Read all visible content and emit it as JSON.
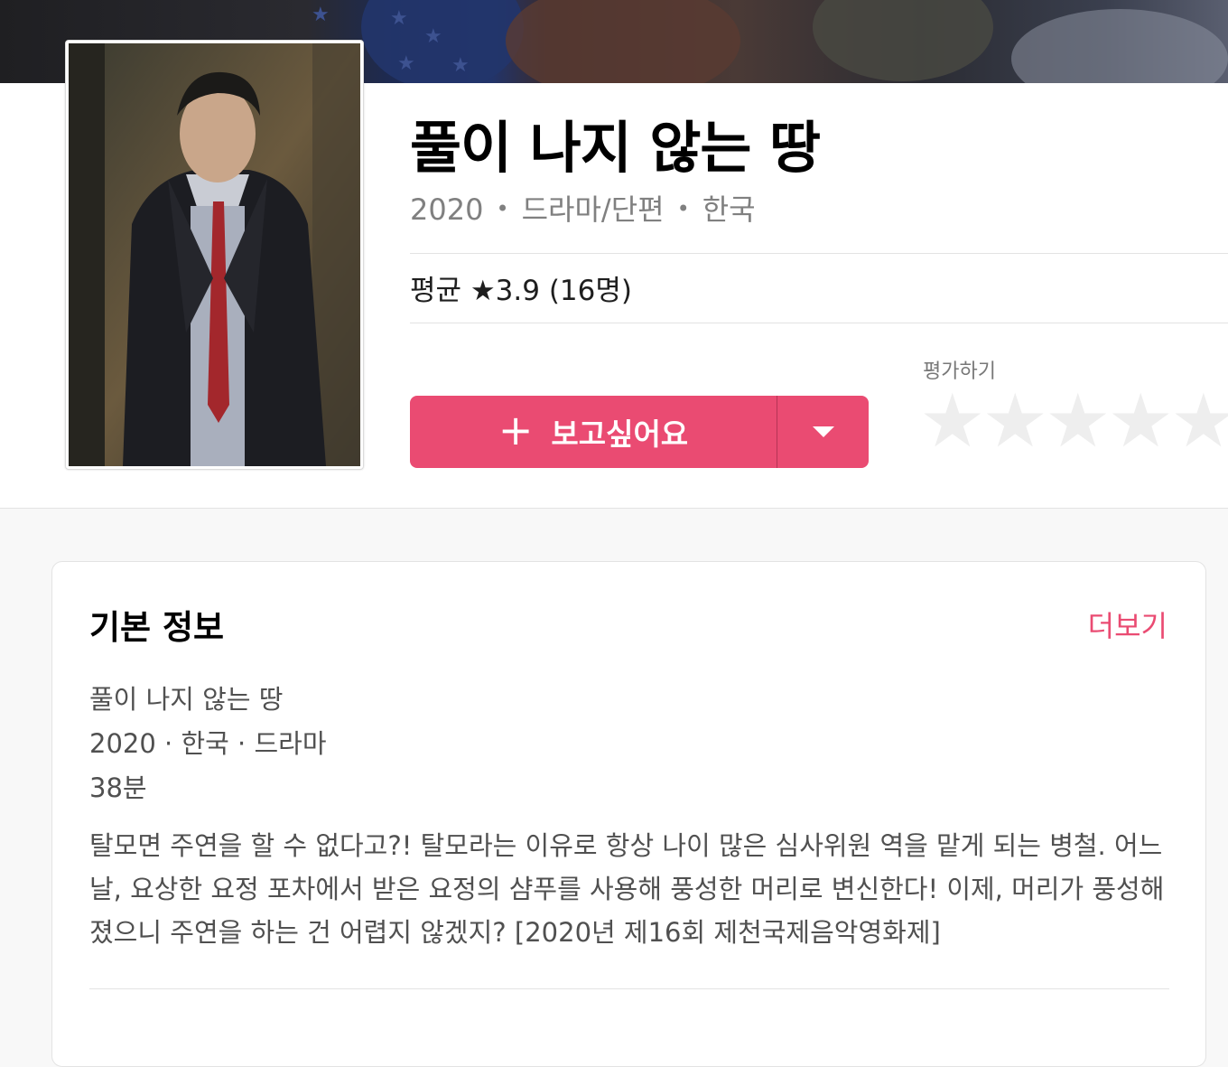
{
  "movie": {
    "title": "풀이 나지 않는 땅",
    "year": "2020",
    "genre": "드라마/단편",
    "country": "한국",
    "separator": "•"
  },
  "rating": {
    "line": "평균 ★3.9 (16명)",
    "average": 3.9,
    "count": 16,
    "rate_label": "평가하기",
    "user_stars": 0
  },
  "actions": {
    "want_label": "보고싶어요",
    "plus_icon": "plus-icon",
    "dropdown_icon": "caret-down-icon"
  },
  "basic_info": {
    "heading": "기본 정보",
    "more_label": "더보기",
    "title_line": "풀이 나지 않는 땅",
    "meta_line": "2020 · 한국 · 드라마",
    "runtime": "38분",
    "synopsis": "탈모면 주연을 할 수 없다고?! 탈모라는 이유로 항상 나이 많은 심사위원 역을 맡게 되는 병철. 어느 날, 요상한 요정 포차에서 받은 요정의 샴푸를 사용해 풍성한 머리로 변신한다! 이제, 머리가 풍성해졌으니 주연을 하는 건 어렵지 않겠지? [2020년 제16회 제천국제음악영화제]"
  },
  "colors": {
    "accent": "#ea4b72",
    "meta_gray": "#808080",
    "star_empty": "#eeeeee"
  }
}
